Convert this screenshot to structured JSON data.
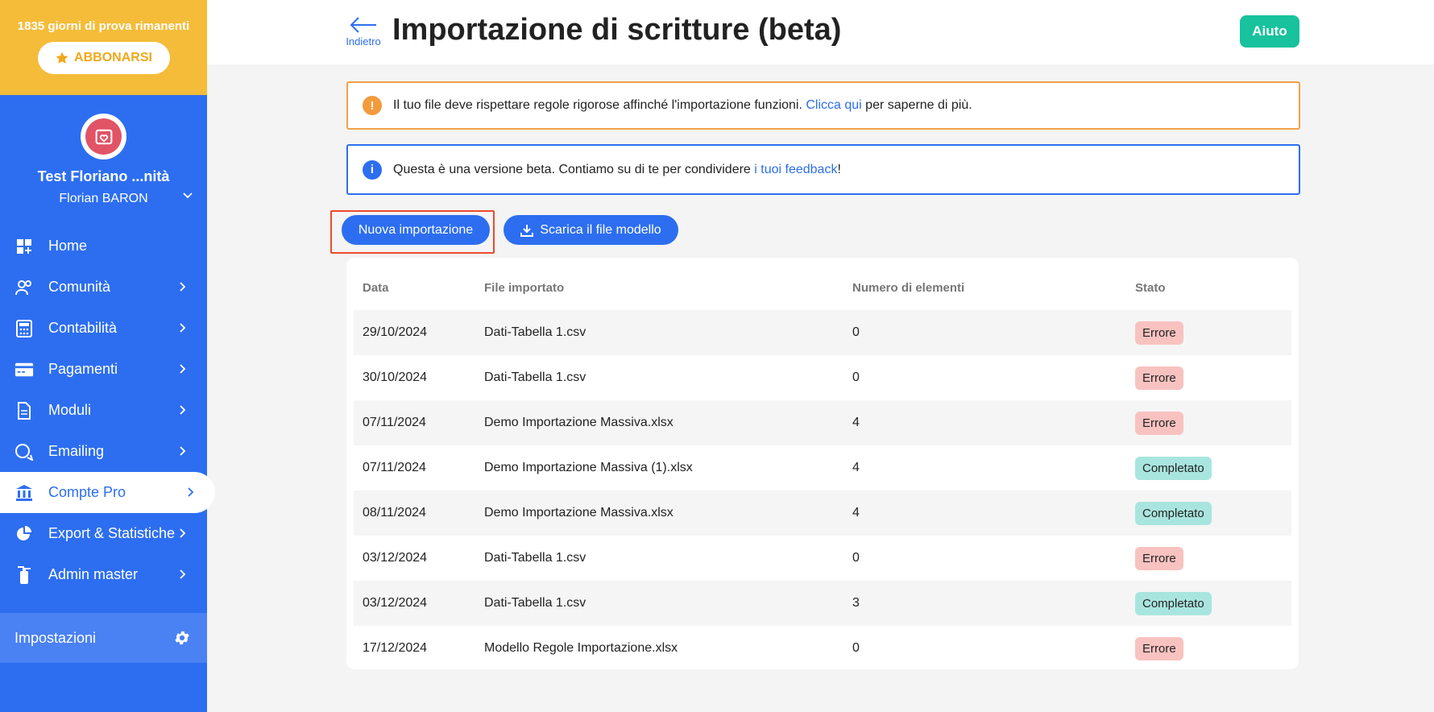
{
  "sidebar": {
    "trial_text": "1835 giorni di prova rimanenti",
    "subscribe_label": "ABBONARSI",
    "org_name": "Test Floriano ...nità",
    "user_name": "Florian BARON",
    "items": [
      {
        "label": "Home",
        "icon": "dashboard-icon"
      },
      {
        "label": "Comunità",
        "icon": "users-icon"
      },
      {
        "label": "Contabilità",
        "icon": "calculator-icon"
      },
      {
        "label": "Pagamenti",
        "icon": "credit-card-icon"
      },
      {
        "label": "Moduli",
        "icon": "document-icon"
      },
      {
        "label": "Emailing",
        "icon": "chat-icon"
      },
      {
        "label": "Compte Pro",
        "icon": "bank-icon"
      },
      {
        "label": "Export & Statistiche",
        "icon": "chart-pie-icon"
      },
      {
        "label": "Admin master",
        "icon": "fire-extinguisher-icon"
      }
    ],
    "active_item": "Compte Pro",
    "settings_label": "Impostazioni"
  },
  "header": {
    "back_label": "Indietro",
    "title": "Importazione di scritture (beta)",
    "help_label": "Aiuto"
  },
  "alerts": {
    "warning": {
      "text_before": "Il tuo file deve rispettare regole rigorose affinché l'importazione funzioni. ",
      "link": "Clicca qui",
      "text_after": " per saperne di più."
    },
    "info": {
      "text_before": "Questa è una versione beta. Contiamo su di te per condividere ",
      "link": "i tuoi feedback",
      "text_after": "!"
    }
  },
  "actions": {
    "new_import": "Nuova importazione",
    "download_template": "Scarica il file modello"
  },
  "table": {
    "headers": [
      "Data",
      "File importato",
      "Numero di elementi",
      "Stato"
    ],
    "rows": [
      {
        "date": "29/10/2024",
        "file": "Dati-Tabella 1.csv",
        "count": "0",
        "status": "Errore"
      },
      {
        "date": "30/10/2024",
        "file": "Dati-Tabella 1.csv",
        "count": "0",
        "status": "Errore"
      },
      {
        "date": "07/11/2024",
        "file": "Demo Importazione Massiva.xlsx",
        "count": "4",
        "status": "Errore"
      },
      {
        "date": "07/11/2024",
        "file": "Demo Importazione Massiva (1).xlsx",
        "count": "4",
        "status": "Completato"
      },
      {
        "date": "08/11/2024",
        "file": "Demo Importazione Massiva.xlsx",
        "count": "4",
        "status": "Completato"
      },
      {
        "date": "03/12/2024",
        "file": "Dati-Tabella 1.csv",
        "count": "0",
        "status": "Errore"
      },
      {
        "date": "03/12/2024",
        "file": "Dati-Tabella 1.csv",
        "count": "3",
        "status": "Completato"
      },
      {
        "date": "17/12/2024",
        "file": "Modello Regole Importazione.xlsx",
        "count": "0",
        "status": "Errore"
      }
    ]
  },
  "colors": {
    "primary": "#2d6ef0",
    "trial_banner": "#f5bc3a",
    "help": "#18c29c",
    "error_badge": "#f8c2c0",
    "success_badge": "#a9e5df",
    "highlight": "#ec4a2c"
  }
}
